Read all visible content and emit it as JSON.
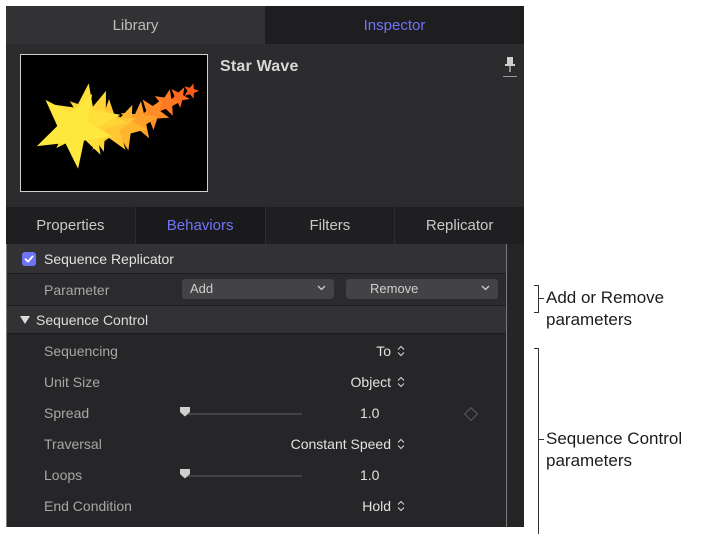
{
  "top_tabs": {
    "library": "Library",
    "inspector": "Inspector"
  },
  "header": {
    "object_name": "Star Wave",
    "pin_icon": "pin-icon"
  },
  "sub_tabs": [
    "Properties",
    "Behaviors",
    "Filters",
    "Replicator"
  ],
  "active_sub_tab": "Behaviors",
  "behavior": {
    "enabled": true,
    "name": "Sequence Replicator",
    "parameter_label": "Parameter",
    "add_dropdown": "Add",
    "remove_dropdown": "Remove"
  },
  "section": {
    "name": "Sequence Control",
    "expanded": true
  },
  "properties": [
    {
      "label": "Sequencing",
      "value": "To"
    },
    {
      "label": "Unit Size",
      "value": "Object"
    },
    {
      "label": "Spread",
      "value": "1.0",
      "slider": 0.05
    },
    {
      "label": "Traversal",
      "value": "Constant Speed"
    },
    {
      "label": "Loops",
      "value": "1.0",
      "slider": 0.05
    },
    {
      "label": "End Condition",
      "value": "Hold"
    }
  ],
  "annotations": {
    "add_remove": [
      "Add or Remove",
      "parameters"
    ],
    "sequence_control": [
      "Sequence Control",
      "parameters"
    ]
  },
  "colors": {
    "accent": "#6f74f5",
    "panel_bg": "#2b2b2d"
  }
}
